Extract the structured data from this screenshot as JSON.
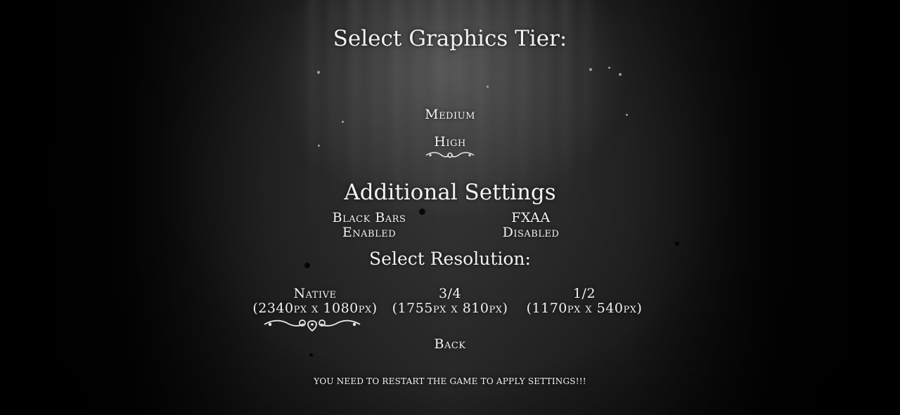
{
  "graphics": {
    "title": "Select Graphics Tier:",
    "options": [
      {
        "label": "Medium",
        "selected": false
      },
      {
        "label": "High",
        "selected": true
      }
    ]
  },
  "additional": {
    "title": "Additional Settings",
    "black_bars": {
      "label": "Black Bars",
      "value": "Enabled"
    },
    "fxaa": {
      "label": "FXAA",
      "value": "Disabled"
    }
  },
  "resolution": {
    "title": "Select Resolution:",
    "options": [
      {
        "label": "Native",
        "detail": "(2340px x 1080px)",
        "selected": true
      },
      {
        "label": "3/4",
        "detail": "(1755px x 810px)",
        "selected": false
      },
      {
        "label": "1/2",
        "detail": "(1170px x 540px)",
        "selected": false
      }
    ]
  },
  "back_label": "Back",
  "notice": "YOU NEED TO RESTART THE GAME TO APPLY SETTINGS!!!",
  "icons": {
    "selection_marker": "ornate-flourish-icon"
  },
  "colors": {
    "background": "#000000",
    "text": "#f3f3f3"
  }
}
